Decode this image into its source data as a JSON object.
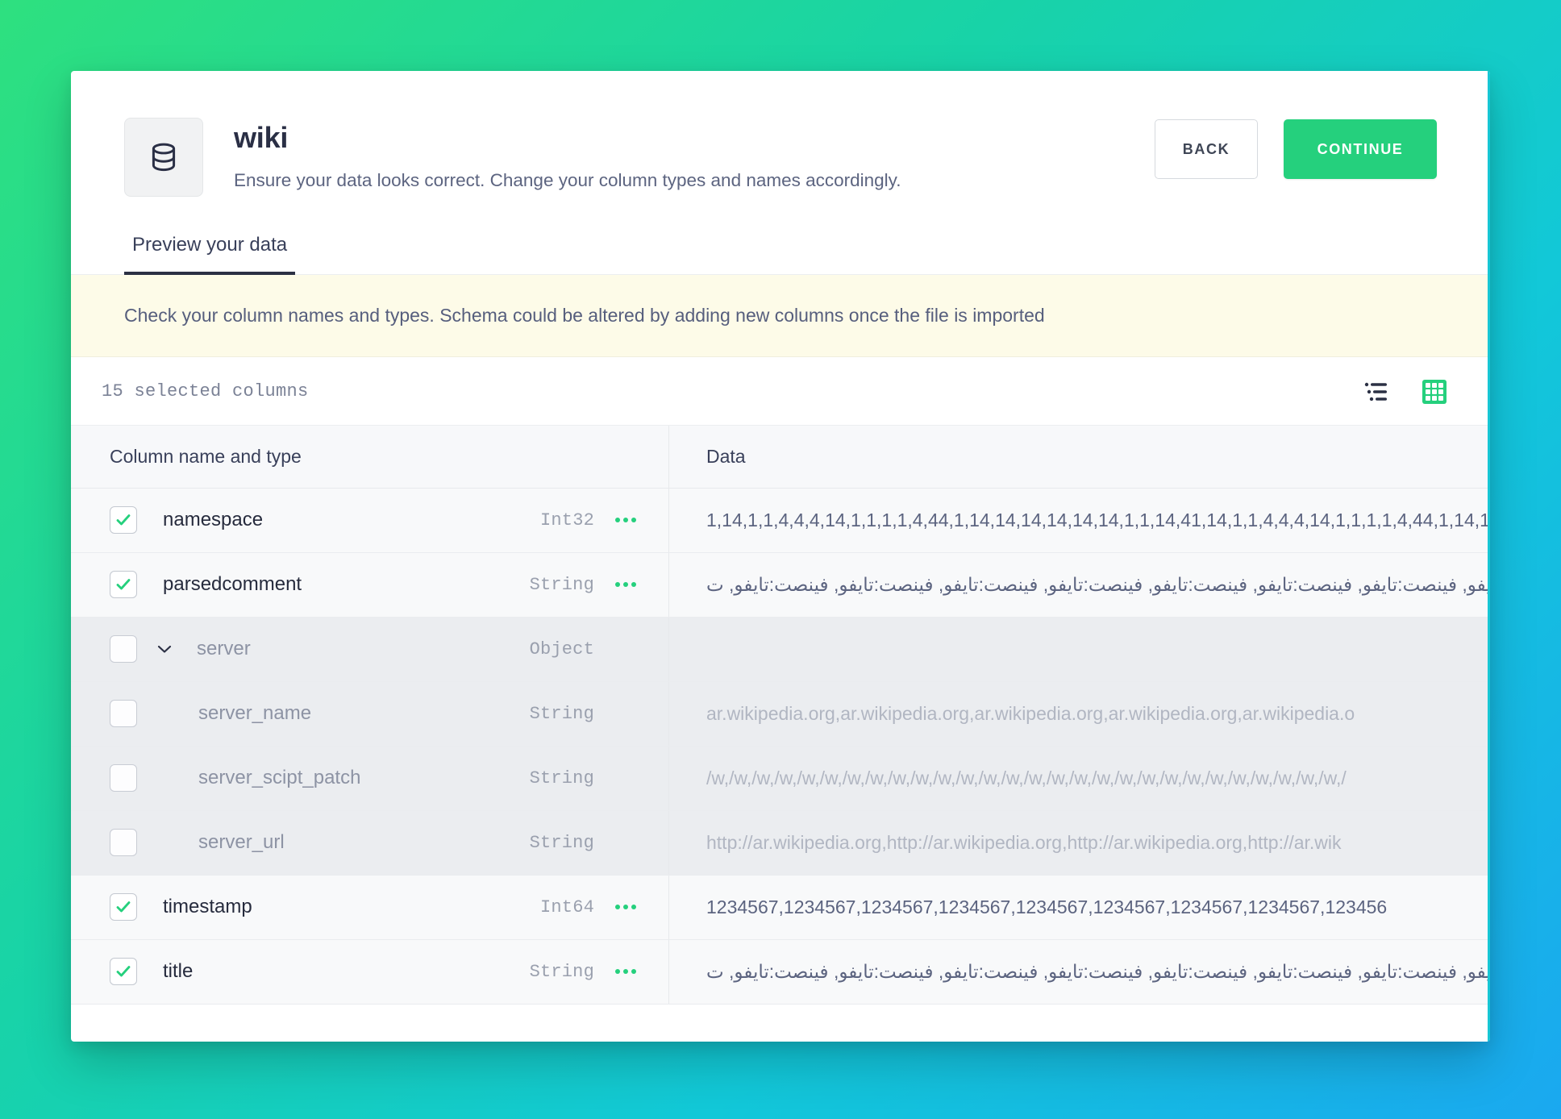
{
  "header": {
    "icon": "database-icon",
    "title": "wiki",
    "subtitle": "Ensure your data looks correct. Change your column types and names accordingly.",
    "back_label": "BACK",
    "continue_label": "CONTINUE"
  },
  "tabs": [
    {
      "label": "Preview your data",
      "active": true
    }
  ],
  "banner": {
    "text": "Check your column names and types. Schema could be altered by adding new columns once the file is imported"
  },
  "toolbar": {
    "selected_count_text": "15 selected columns",
    "list_view_icon": "tree-list-icon",
    "grid_view_icon": "grid-view-icon",
    "active_view": "grid"
  },
  "table": {
    "headers": {
      "name": "Column name and type",
      "data": "Data"
    },
    "rows": [
      {
        "name": "namespace",
        "type": "Int32",
        "checked": true,
        "expandable": false,
        "child": false,
        "menu": true,
        "data": "1,14,1,1,4,4,4,14,1,1,1,1,4,44,1,14,14,14,14,14,14,1,1,14,41,14,1,1,4,4,4,14,1,1,1,1,4,44,1,14,1",
        "rtl": false
      },
      {
        "name": "parsedcomment",
        "type": "String",
        "checked": true,
        "expandable": false,
        "child": false,
        "menu": true,
        "data": "فينصت:تايفو, فينصت:تايفو, فينصت:تايفو, فينصت:تايفو, فينصت:تايفو, فينصت:تايفو, فينصت:تايفو, فينصت:تايفو, فينصت:تايفو, ت",
        "rtl": true
      },
      {
        "name": "server",
        "type": "Object",
        "checked": false,
        "expandable": true,
        "child": false,
        "menu": false,
        "data": "",
        "rtl": false
      },
      {
        "name": "server_name",
        "type": "String",
        "checked": false,
        "expandable": false,
        "child": true,
        "menu": false,
        "data": "ar.wikipedia.org,ar.wikipedia.org,ar.wikipedia.org,ar.wikipedia.org,ar.wikipedia.o",
        "rtl": false
      },
      {
        "name": "server_scipt_patch",
        "type": "String",
        "checked": false,
        "expandable": false,
        "child": true,
        "menu": false,
        "data": "/w,/w,/w,/w,/w,/w,/w,/w,/w,/w,/w,/w,/w,/w,/w,/w,/w,/w,/w,/w,/w,/w,/w,/w,/w,/w,/w,/w,/",
        "rtl": false
      },
      {
        "name": "server_url",
        "type": "String",
        "checked": false,
        "expandable": false,
        "child": true,
        "menu": false,
        "data": "http://ar.wikipedia.org,http://ar.wikipedia.org,http://ar.wikipedia.org,http://ar.wik",
        "rtl": false
      },
      {
        "name": "timestamp",
        "type": "Int64",
        "checked": true,
        "expandable": false,
        "child": false,
        "menu": true,
        "data": "1234567,1234567,1234567,1234567,1234567,1234567,1234567,1234567,123456",
        "rtl": false
      },
      {
        "name": "title",
        "type": "String",
        "checked": true,
        "expandable": false,
        "child": false,
        "menu": true,
        "data": "فينصت:تايفو, فينصت:تايفو, فينصت:تايفو, فينصت:تايفو, فينصت:تايفو, فينصت:تايفو, فينصت:تايفو, فينصت:تايفو, فينصت:تايفو, ت",
        "rtl": true
      }
    ]
  },
  "colors": {
    "accent_green": "#25d07d",
    "banner_bg": "#fdfbe8",
    "text_dark": "#2a2f45",
    "text_muted": "#8d93a4"
  }
}
